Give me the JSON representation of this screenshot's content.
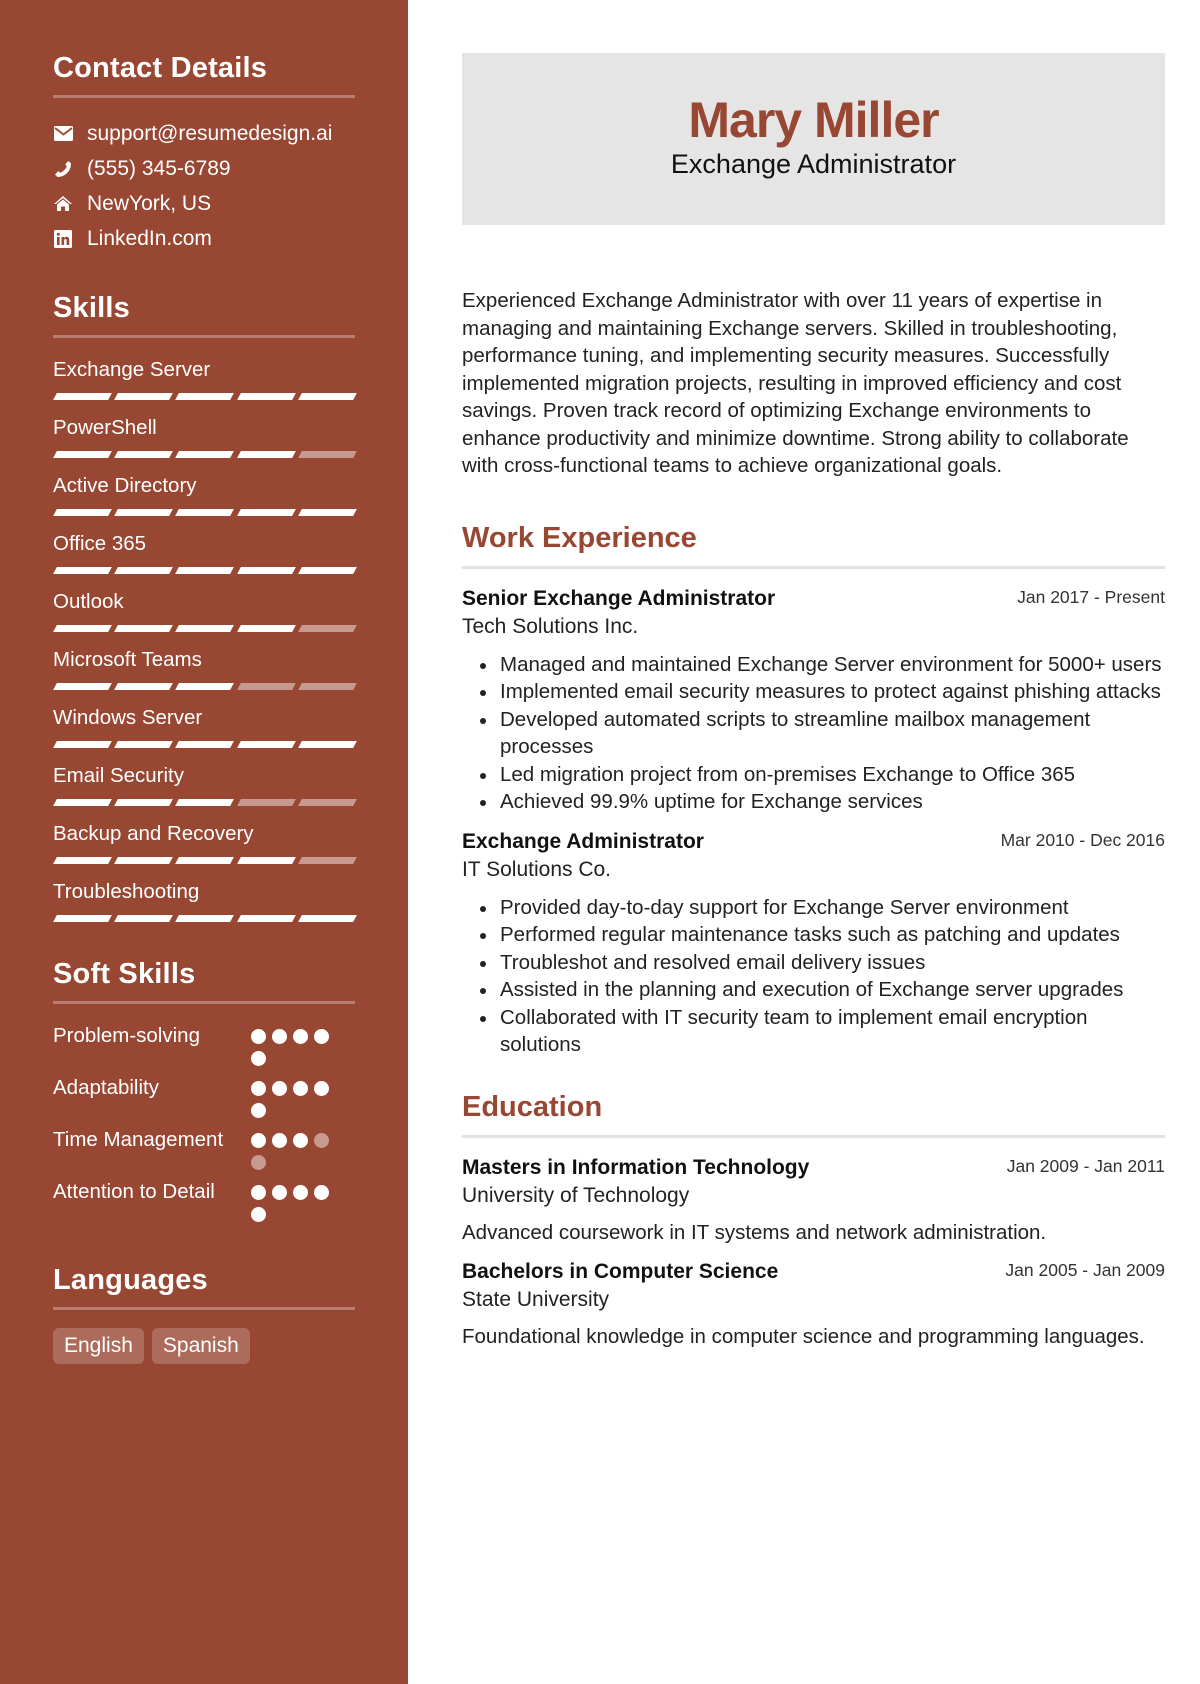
{
  "sidebar": {
    "contact": {
      "title": "Contact Details",
      "items": [
        {
          "icon": "envelope-icon",
          "text": "support@resumedesign.ai"
        },
        {
          "icon": "phone-icon",
          "text": "(555) 345-6789"
        },
        {
          "icon": "home-icon",
          "text": "NewYork, US"
        },
        {
          "icon": "linkedin-icon",
          "text": "LinkedIn.com"
        }
      ]
    },
    "skills": {
      "title": "Skills",
      "items": [
        {
          "name": "Exchange Server",
          "level": 5,
          "max": 5
        },
        {
          "name": "PowerShell",
          "level": 4,
          "max": 5
        },
        {
          "name": "Active Directory",
          "level": 5,
          "max": 5
        },
        {
          "name": "Office 365",
          "level": 5,
          "max": 5
        },
        {
          "name": "Outlook",
          "level": 4,
          "max": 5
        },
        {
          "name": "Microsoft Teams",
          "level": 3,
          "max": 5
        },
        {
          "name": "Windows Server",
          "level": 5,
          "max": 5
        },
        {
          "name": "Email Security",
          "level": 3,
          "max": 5
        },
        {
          "name": "Backup and Recovery",
          "level": 4,
          "max": 5
        },
        {
          "name": "Troubleshooting",
          "level": 5,
          "max": 5
        }
      ]
    },
    "soft_skills": {
      "title": "Soft Skills",
      "items": [
        {
          "name": "Problem-solving",
          "level": 5,
          "max": 5
        },
        {
          "name": "Adaptability",
          "level": 5,
          "max": 5
        },
        {
          "name": "Time Management",
          "level": 3,
          "max": 5
        },
        {
          "name": "Attention to Detail",
          "level": 5,
          "max": 5
        }
      ]
    },
    "languages": {
      "title": "Languages",
      "items": [
        "English",
        "Spanish"
      ]
    }
  },
  "header": {
    "name": "Mary Miller",
    "title": "Exchange Administrator"
  },
  "summary": "Experienced Exchange Administrator with over 11 years of expertise in managing and maintaining Exchange servers. Skilled in troubleshooting, performance tuning, and implementing security measures. Successfully implemented migration projects, resulting in improved efficiency and cost savings. Proven track record of optimizing Exchange environments to enhance productivity and minimize downtime. Strong ability to collaborate with cross-functional teams to achieve organizational goals.",
  "work": {
    "title": "Work Experience",
    "entries": [
      {
        "role": "Senior Exchange Administrator",
        "date": "Jan 2017 - Present",
        "org": "Tech Solutions Inc.",
        "bullets": [
          "Managed and maintained Exchange Server environment for 5000+ users",
          "Implemented email security measures to protect against phishing attacks",
          "Developed automated scripts to streamline mailbox management processes",
          "Led migration project from on-premises Exchange to Office 365",
          "Achieved 99.9% uptime for Exchange services"
        ]
      },
      {
        "role": "Exchange Administrator",
        "date": "Mar 2010 - Dec 2016",
        "org": "IT Solutions Co.",
        "bullets": [
          "Provided day-to-day support for Exchange Server environment",
          "Performed regular maintenance tasks such as patching and updates",
          "Troubleshot and resolved email delivery issues",
          "Assisted in the planning and execution of Exchange server upgrades",
          "Collaborated with IT security team to implement email encryption solutions"
        ]
      }
    ]
  },
  "education": {
    "title": "Education",
    "entries": [
      {
        "degree": "Masters in Information Technology",
        "date": "Jan 2009 - Jan 2011",
        "school": "University of Technology",
        "desc": "Advanced coursework in IT systems and network administration."
      },
      {
        "degree": "Bachelors in Computer Science",
        "date": "Jan 2005 - Jan 2009",
        "school": "State University",
        "desc": "Foundational knowledge in computer science and programming languages."
      }
    ]
  },
  "colors": {
    "accent": "#984732",
    "header_bg": "#e5e5e5",
    "rule": "#e3e3e3"
  }
}
